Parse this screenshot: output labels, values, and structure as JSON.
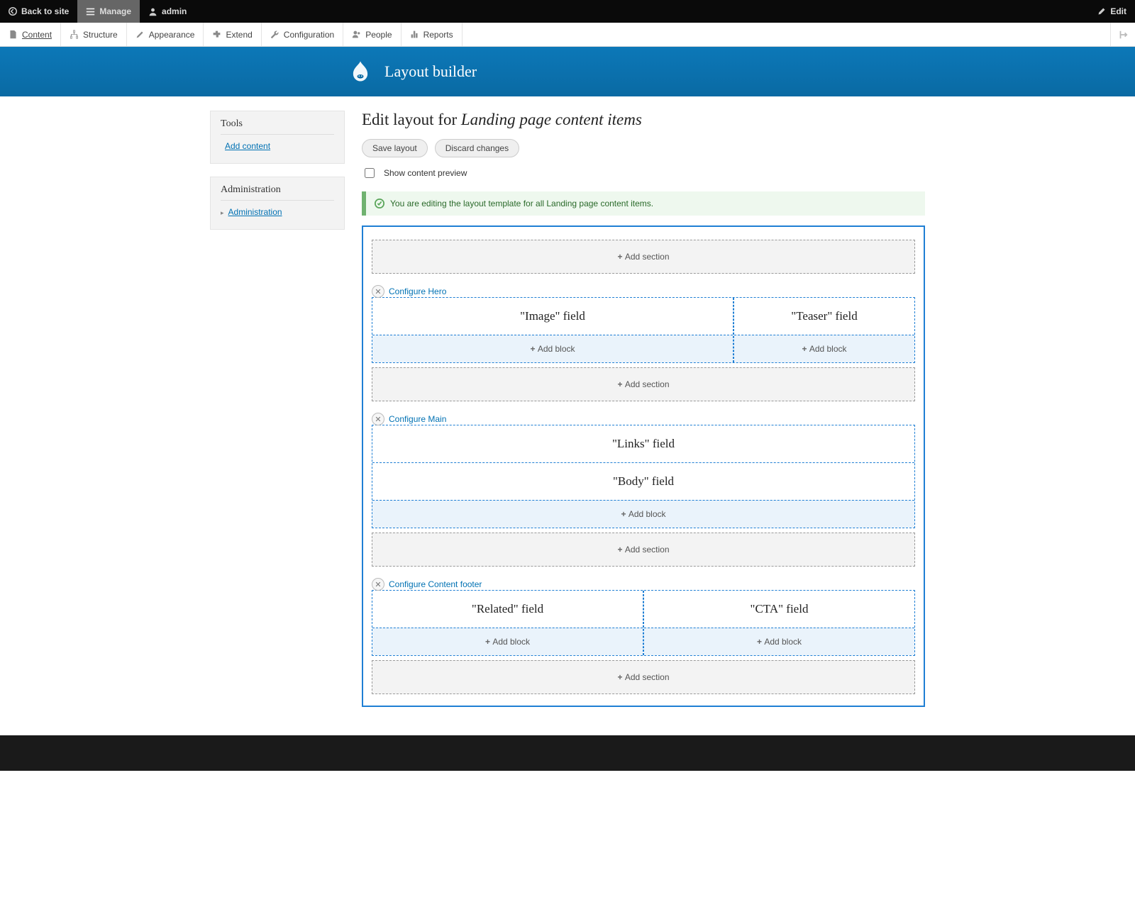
{
  "topbar": {
    "back": "Back to site",
    "manage": "Manage",
    "user": "admin",
    "edit": "Edit"
  },
  "adminmenu": {
    "content": "Content",
    "structure": "Structure",
    "appearance": "Appearance",
    "extend": "Extend",
    "configuration": "Configuration",
    "people": "People",
    "reports": "Reports"
  },
  "header": {
    "title": "Layout builder"
  },
  "sidebar": {
    "tools_heading": "Tools",
    "add_content": "Add content",
    "admin_heading": "Administration",
    "admin_link": "Administration"
  },
  "main": {
    "heading_prefix": "Edit layout for ",
    "heading_em": "Landing page content items",
    "save": "Save layout",
    "discard": "Discard changes",
    "preview_label": "Show content preview",
    "status": "You are editing the layout template for all Landing page content items."
  },
  "labels": {
    "add_section": "Add section",
    "add_block": "Add block"
  },
  "sections": {
    "hero": {
      "configure": "Configure Hero",
      "fields": {
        "image": "\"Image\" field",
        "teaser": "\"Teaser\" field"
      }
    },
    "mainsec": {
      "configure": "Configure Main",
      "fields": {
        "links": "\"Links\" field",
        "body": "\"Body\" field"
      }
    },
    "footer": {
      "configure": "Configure Content footer",
      "fields": {
        "related": "\"Related\" field",
        "cta": "\"CTA\" field"
      }
    }
  }
}
